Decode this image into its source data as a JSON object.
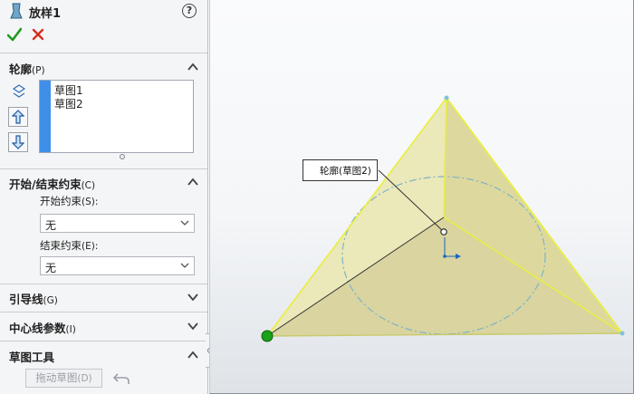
{
  "feature": {
    "title": "放样1",
    "help_glyph": "?",
    "icon": "loft-icon"
  },
  "actions": {
    "ok_icon": "checkmark-icon",
    "cancel_icon": "close-icon"
  },
  "sections": {
    "profiles": {
      "title": "轮廓",
      "shortcut": "(P)",
      "items": [
        "草图1",
        "草图2"
      ]
    },
    "start_end": {
      "title": "开始/结束约束",
      "shortcut": "(C)",
      "start_label": "开始约束",
      "start_shortcut": "(S):",
      "start_value": "无",
      "end_label": "结束约束",
      "end_shortcut": "(E):",
      "end_value": "无"
    },
    "guides": {
      "title": "引导线",
      "shortcut": "(G)"
    },
    "centerline": {
      "title": "中心线参数",
      "shortcut": "(I)"
    },
    "sketch_tools": {
      "title": "草图工具",
      "drag_label": "拖动草图",
      "drag_shortcut": "(D)"
    }
  },
  "viewport": {
    "callout_text": "轮廓(草图2)",
    "colors": {
      "face_fill": "#e2e0a6",
      "edge_highlight": "#e9ef3c",
      "sketch_line": "#7fb3c5",
      "origin": "#1565c0",
      "start_point": "#1aa31a"
    }
  }
}
